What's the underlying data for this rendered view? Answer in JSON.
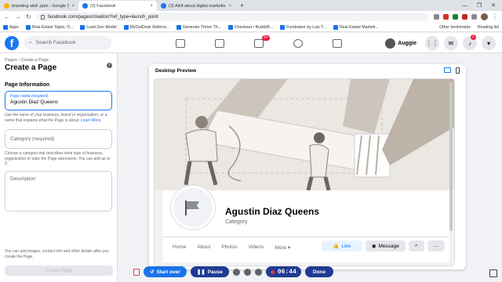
{
  "browser": {
    "tabs": [
      {
        "label": "branding aik8 .pptx - Google Sl",
        "color": "#f4b400",
        "active": false
      },
      {
        "label": "(2) Facebook",
        "color": "#1877f2",
        "active": true
      },
      {
        "label": "(3) Aik8 about digital marketing",
        "color": "#1877f2",
        "active": false
      }
    ],
    "url": "facebook.com/pages/creation?ref_type=launch_point",
    "bookmarks": [
      "Apps",
      "Real Estate Signs, O...",
      "Lead Gen Model",
      "MyOutDesk Referra...",
      "Generate Thrive Th...",
      "Checkout • BuddyB...",
      "Fundraiser by Luis T...",
      "Real Estate Marketi..."
    ],
    "bookmarks_right": [
      "Other bookmarks",
      "Reading list"
    ]
  },
  "fbnav": {
    "logo": "f",
    "search_placeholder": "Search Facebook",
    "video_badge": "9+",
    "user_name": "Auggie",
    "notif_badge": "2"
  },
  "left": {
    "breadcrumb": "Pages › Create a Page",
    "title": "Create a Page",
    "section": "Page Information",
    "name_label": "Page name (required)",
    "name_value": "Agustin Diaz Queens",
    "name_helper": "Use the name of your business, brand or organization, or a name that explains what the Page is about.",
    "learn_more": "Learn More",
    "category_placeholder": "Category (required)",
    "category_helper": "Choose a category that describes what type of business, organization or topic the Page represents. You can add up to 3.",
    "description_placeholder": "Description",
    "bottom_note": "You can add images, contact info and other details after you create the Page.",
    "create_button": "Create Page"
  },
  "preview": {
    "header": "Desktop Preview",
    "page_name": "Agustin Diaz Queens",
    "category": "Category",
    "tabs": [
      "Home",
      "About",
      "Photos",
      "Videos",
      "More ▾"
    ],
    "like": "Like",
    "message": "Message"
  },
  "recorder": {
    "start": "Start over",
    "pause": "Pause",
    "timer": "06:44",
    "done": "Done"
  }
}
